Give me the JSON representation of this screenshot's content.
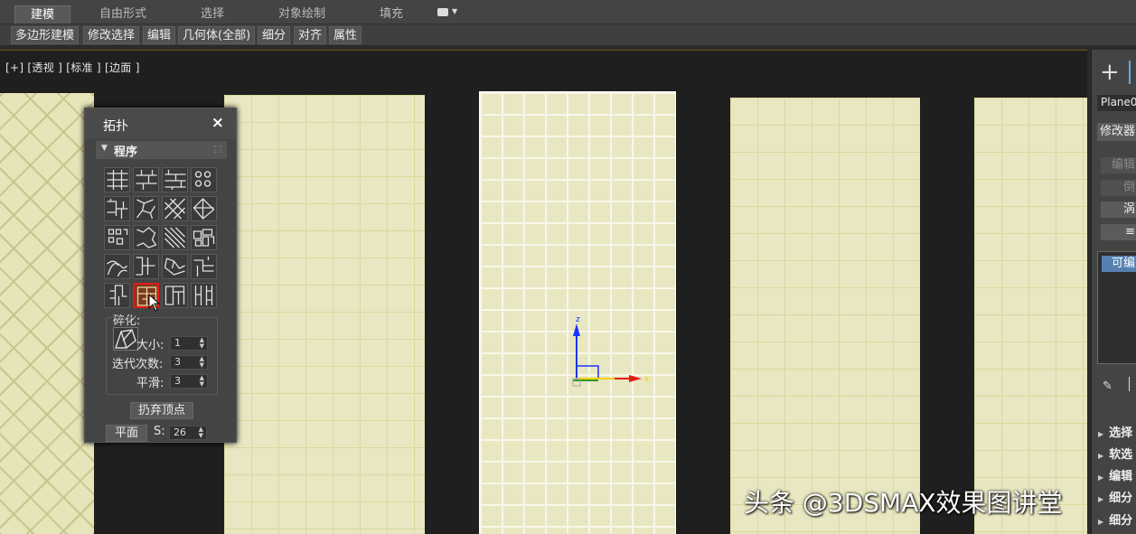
{
  "ribbon": {
    "tabs": [
      {
        "label": "建模",
        "active": true
      },
      {
        "label": "自由形式",
        "active": false
      },
      {
        "label": "选择",
        "active": false
      },
      {
        "label": "对象绘制",
        "active": false
      },
      {
        "label": "填充",
        "active": false
      }
    ],
    "options_icon": "dropdown-menu-icon"
  },
  "subtoolbar": {
    "items": [
      "多边形建模",
      "修改选择",
      "编辑",
      "几何体(全部)",
      "细分",
      "对齐",
      "属性"
    ]
  },
  "viewport": {
    "label": "[+] [透视 ] [标准 ] [边面 ]",
    "gizmo": {
      "z_label": "z",
      "x_label": "x"
    }
  },
  "topology_panel": {
    "title": "拓扑",
    "close_label": "×",
    "section_label": "程序",
    "pattern_buttons": [
      "pattern-01",
      "pattern-02",
      "pattern-03",
      "pattern-04",
      "pattern-05",
      "pattern-06",
      "pattern-07",
      "pattern-08",
      "pattern-09",
      "pattern-10",
      "pattern-11",
      "pattern-12",
      "pattern-13",
      "pattern-14",
      "pattern-15",
      "pattern-16",
      "pattern-17",
      "pattern-18",
      "pattern-19",
      "pattern-20"
    ],
    "selected_pattern_index": 17,
    "fragment_group": {
      "label": "碎化:",
      "fields": [
        {
          "label": "大小:",
          "value": "1"
        },
        {
          "label": "迭代次数:",
          "value": "3"
        },
        {
          "label": "平滑:",
          "value": "3"
        }
      ]
    },
    "discard_vertices_label": "扔弃顶点",
    "plane_label": "平面",
    "s_label": "S:",
    "s_value": "26"
  },
  "command_panel": {
    "plus_icon": "create-plus-icon",
    "object_name": "Plane0",
    "modifier_list": "修改器",
    "buttons": [
      {
        "label": "编辑",
        "enabled": false
      },
      {
        "label": "倒",
        "enabled": false
      },
      {
        "label": "涡",
        "enabled": true
      },
      {
        "label": "≡",
        "enabled": true
      }
    ],
    "stack_item": "可编",
    "pin_icon": "pin-stack-icon",
    "rollouts": [
      "选择",
      "软选",
      "编辑",
      "细分",
      "细分"
    ]
  },
  "watermark": "头条 @3DSMAX效果图讲堂"
}
